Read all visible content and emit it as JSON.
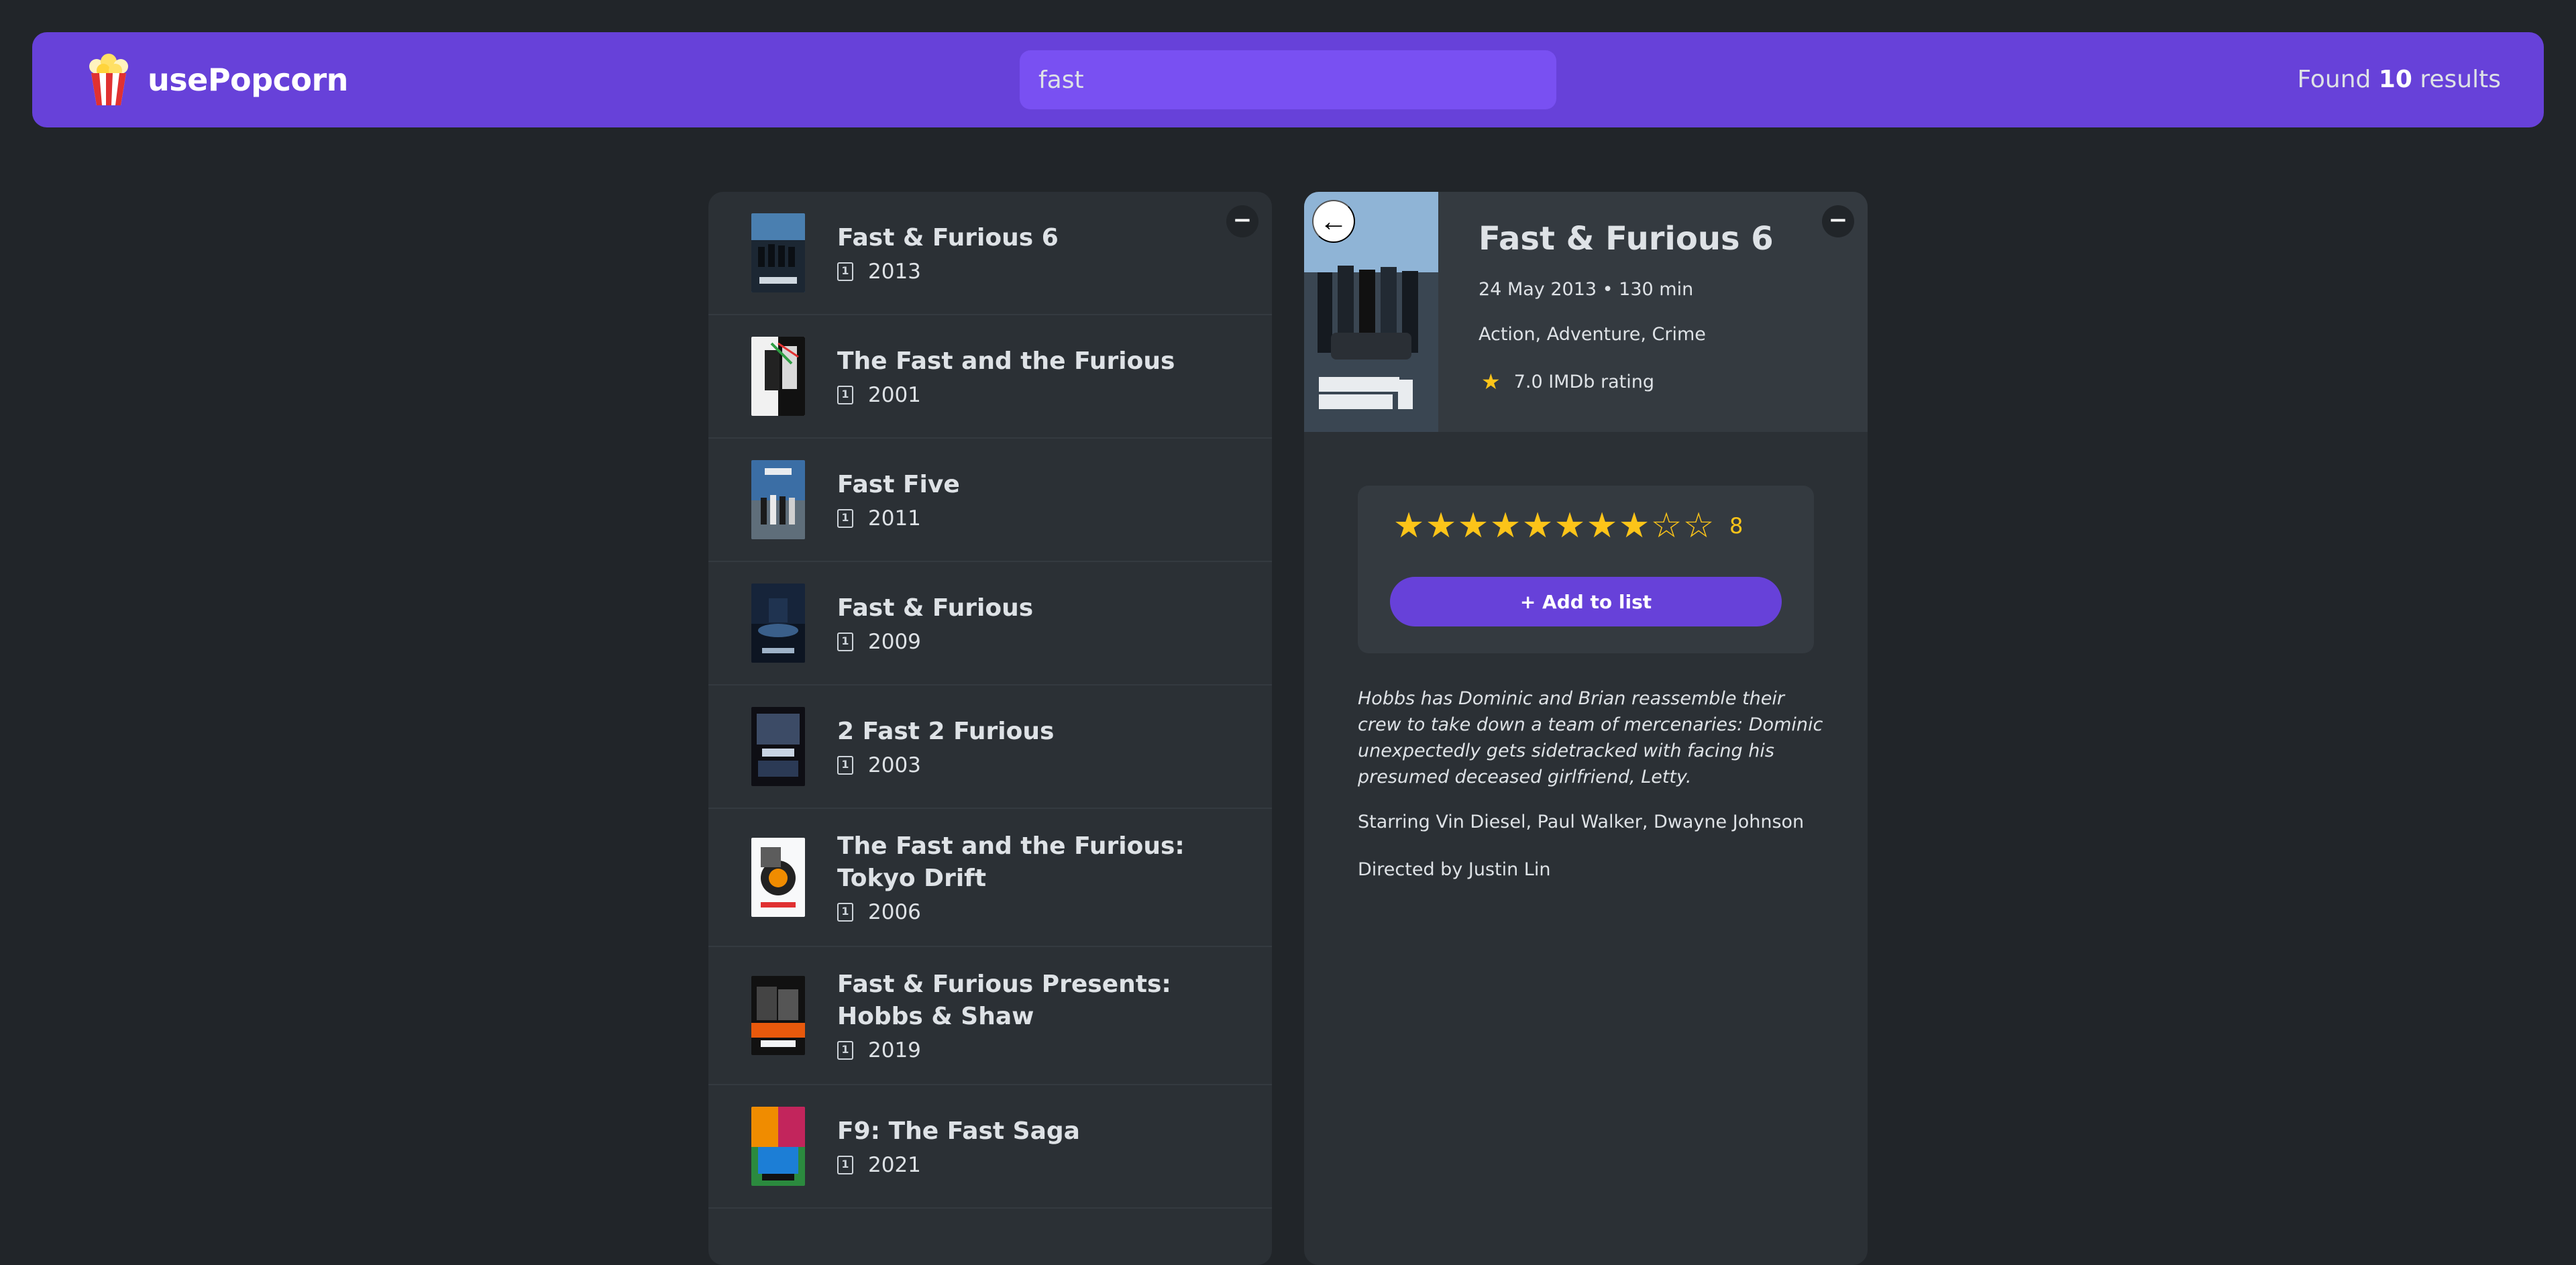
{
  "nav": {
    "logo_text": "usePopcorn",
    "search_value": "fast",
    "results_prefix": "Found",
    "results_count": "10",
    "results_suffix": "results"
  },
  "list": {
    "toggle_label": "−",
    "movies": [
      {
        "title": "Fast & Furious 6",
        "year": "2013"
      },
      {
        "title": "The Fast and the Furious",
        "year": "2001"
      },
      {
        "title": "Fast Five",
        "year": "2011"
      },
      {
        "title": "Fast & Furious",
        "year": "2009"
      },
      {
        "title": "2 Fast 2 Furious",
        "year": "2003"
      },
      {
        "title": "The Fast and the Furious: Tokyo Drift",
        "year": "2006"
      },
      {
        "title": "Fast & Furious Presents: Hobbs & Shaw",
        "year": "2019"
      },
      {
        "title": "F9: The Fast Saga",
        "year": "2021"
      }
    ]
  },
  "details": {
    "toggle_label": "−",
    "back_label": "←",
    "title": "Fast & Furious 6",
    "released_runtime": "24 May 2013 • 130 min",
    "genres": "Action, Adventure, Crime",
    "imdb_rating": "7.0 IMDb rating",
    "user_rating": "8",
    "user_rating_max": 10,
    "add_button": "+ Add to list",
    "plot": "Hobbs has Dominic and Brian reassemble their crew to take down a team of mercenaries: Dominic unexpectedly gets sidetracked with facing his presumed deceased girlfriend, Letty.",
    "starring": "Starring Vin Diesel, Paul Walker, Dwayne Johnson",
    "directed": "Directed by Justin Lin"
  },
  "colors": {
    "accent": "#6741d9",
    "search_bg": "#7950f2",
    "star": "#fcc419",
    "background": "#212529",
    "box": "#2b3035"
  }
}
